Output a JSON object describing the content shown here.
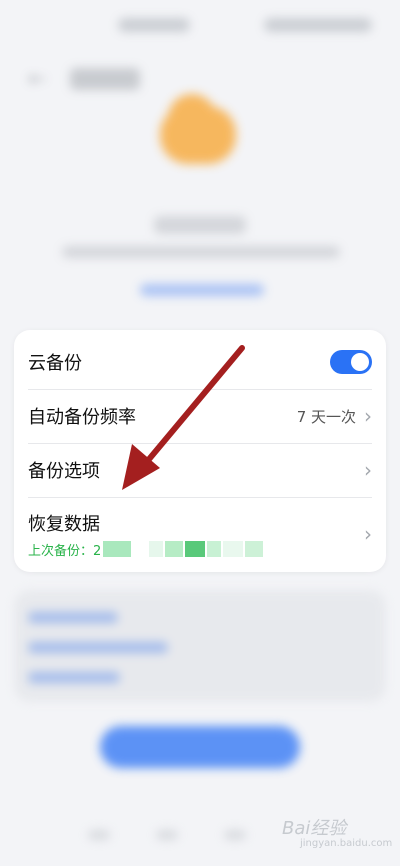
{
  "settings": {
    "cloud_backup_label": "云备份",
    "cloud_backup_on": true,
    "auto_backup_frequency_label": "自动备份频率",
    "auto_backup_frequency_value": "7 天一次",
    "backup_options_label": "备份选项",
    "restore_data_label": "恢复数据",
    "last_backup_label": "上次备份：2"
  },
  "watermark": {
    "brand": "Bai经验",
    "sub": "jingyan.baidu.com"
  },
  "colors": {
    "accent": "#2a72f5",
    "success_text": "#29b34a",
    "annotation": "#a41f1f",
    "brand_logo": "#f8a32b"
  },
  "icons": {
    "chevron": "chevron-right-icon",
    "back": "back-arrow-icon",
    "arrow": "annotation-arrow"
  }
}
